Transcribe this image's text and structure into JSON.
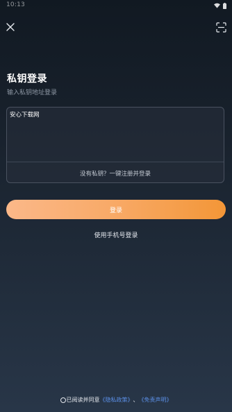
{
  "status_bar": {
    "time": "10:13",
    "icons": [
      "wifi-icon",
      "battery-icon"
    ]
  },
  "header": {
    "close_icon": "close-icon",
    "scan_icon": "scan-icon"
  },
  "main": {
    "title": "私钥登录",
    "subtitle": "输入私钥地址登录",
    "key_input_value": "安心下载网",
    "no_key_link": "没有私钥？一键注册并登录",
    "login_button": "登录",
    "phone_login_link": "使用手机号登录"
  },
  "footer": {
    "agreement_prefix": "已阅读并同意",
    "privacy_policy": "《隐私政策》",
    "separator": "、",
    "disclaimer": "《免责声明》"
  },
  "colors": {
    "accent_start": "#fbb889",
    "accent_end": "#f39637",
    "link": "#5b8fe6",
    "background_top": "#111922",
    "background_bottom": "#283648"
  }
}
